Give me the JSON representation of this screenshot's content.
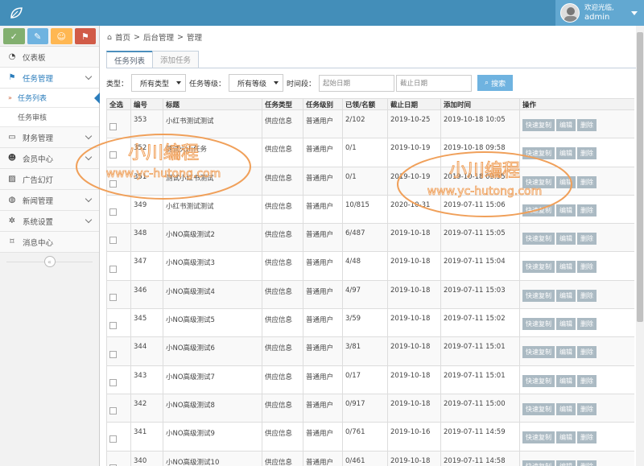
{
  "header": {
    "welcome": "欢迎光临,",
    "username": "admin"
  },
  "colors": {
    "topbar": "#438eb9",
    "shortcut1": "#82af6f",
    "shortcut2": "#6fb3e0",
    "shortcut3": "#ffb752",
    "shortcut4": "#d15b47",
    "accent": "#2b7dbc"
  },
  "shortcuts": [
    "✓",
    "✎",
    "☺",
    "⚑"
  ],
  "sidebar": {
    "items": [
      {
        "label": "仪表板",
        "icon": "dashboard-icon",
        "glyph": "◔"
      },
      {
        "label": "任务管理",
        "icon": "flag-icon",
        "glyph": "⚑"
      },
      {
        "label": "财务管理",
        "icon": "wallet-icon",
        "glyph": "▭"
      },
      {
        "label": "会员中心",
        "icon": "user-icon",
        "glyph": "☻"
      },
      {
        "label": "广告幻灯",
        "icon": "picture-icon",
        "glyph": "▨"
      },
      {
        "label": "新闻管理",
        "icon": "globe-icon",
        "glyph": "◍"
      },
      {
        "label": "系统设置",
        "icon": "gear-icon",
        "glyph": "✲"
      },
      {
        "label": "消息中心",
        "icon": "bookmark-icon",
        "glyph": "⌑"
      }
    ],
    "sub": [
      "任务列表",
      "任务审核"
    ],
    "collapse": "«"
  },
  "breadcrumb": {
    "home": "首页",
    "sep": ">",
    "b1": "后台管理",
    "b2": "管理"
  },
  "tabs": [
    "任务列表",
    "添加任务"
  ],
  "filters": {
    "type_label": "类型：",
    "type_value": "所有类型",
    "level_label": "任务等级：",
    "level_value": "所有等级",
    "period_label": "时间段：",
    "start_placeholder": "起始日期",
    "end_placeholder": "截止日期",
    "search": "搜索"
  },
  "table": {
    "headers": [
      "全选",
      "编号",
      "标题",
      "任务类型",
      "任务级别",
      "已领/名额",
      "截止日期",
      "添加时间",
      "操作"
    ],
    "ops": [
      "快速复制",
      "编辑",
      "删除"
    ],
    "rows": [
      [
        "353",
        "小红书测试测试",
        "供应信息",
        "普通用户",
        "2/102",
        "2019-10-25",
        "2019-10-18 10:05"
      ],
      [
        "352",
        "测试火山任务",
        "供应信息",
        "普通用户",
        "0/1",
        "2019-10-19",
        "2019-10-18 09:58"
      ],
      [
        "351",
        "测试小红书测试",
        "供应信息",
        "普通用户",
        "0/1",
        "2019-10-19",
        "2019-10-18 09:55"
      ],
      [
        "349",
        "小红书测试测试",
        "供应信息",
        "普通用户",
        "10/815",
        "2020-10-31",
        "2019-07-11 15:06"
      ],
      [
        "348",
        "小NO高级测试2",
        "供应信息",
        "普通用户",
        "6/487",
        "2019-10-18",
        "2019-07-11 15:05"
      ],
      [
        "347",
        "小NO高级测试3",
        "供应信息",
        "普通用户",
        "4/48",
        "2019-10-18",
        "2019-07-11 15:04"
      ],
      [
        "346",
        "小NO高级测试4",
        "供应信息",
        "普通用户",
        "4/97",
        "2019-10-18",
        "2019-07-11 15:03"
      ],
      [
        "345",
        "小NO高级测试5",
        "供应信息",
        "普通用户",
        "3/59",
        "2019-10-18",
        "2019-07-11 15:02"
      ],
      [
        "344",
        "小NO高级测试6",
        "供应信息",
        "普通用户",
        "3/81",
        "2019-10-18",
        "2019-07-11 15:01"
      ],
      [
        "343",
        "小NO高级测试7",
        "供应信息",
        "普通用户",
        "0/17",
        "2019-10-18",
        "2019-07-11 15:01"
      ],
      [
        "342",
        "小NO高级测试8",
        "供应信息",
        "普通用户",
        "0/917",
        "2019-10-18",
        "2019-07-11 15:00"
      ],
      [
        "341",
        "小NO高级测试9",
        "供应信息",
        "普通用户",
        "0/761",
        "2019-10-16",
        "2019-07-11 14:59"
      ],
      [
        "340",
        "小NO高级测试10",
        "供应信息",
        "普通用户",
        "0/461",
        "2019-10-18",
        "2019-07-11 14:58"
      ]
    ]
  },
  "watermark": {
    "cn": "小川编程",
    "url": "www.yc-hutong.com"
  }
}
